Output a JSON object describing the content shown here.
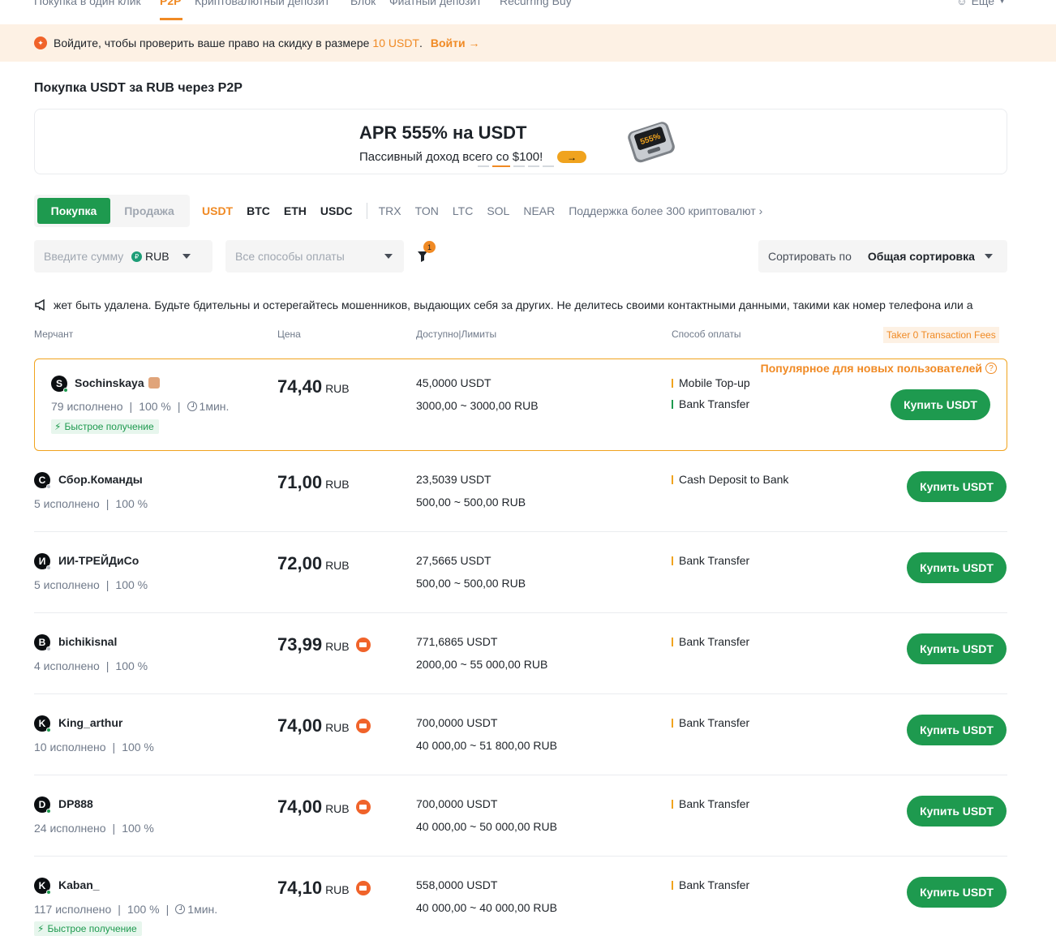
{
  "topnav": {
    "items": [
      "Покупка в один клик",
      "P2P",
      "Криптовалютный депозит",
      "Блок",
      "Фиатный депозит",
      "Recurring Buy"
    ],
    "more": "Еще"
  },
  "promo": {
    "text": "Войдите, чтобы проверить ваше право на скидку в размере",
    "amount": "10 USDT",
    "dot": ".",
    "login": "Войти →"
  },
  "page_title": "Покупка USDT за RUB через P2P",
  "banner": {
    "title": "APR 555% на USDT",
    "subtitle": "Пассивный доход всего со $100!",
    "device_text": "555%"
  },
  "tradeSide": {
    "buy": "Покупка",
    "sell": "Продажа"
  },
  "coins": {
    "primary": [
      "USDT",
      "BTC",
      "ETH",
      "USDC"
    ],
    "secondary": [
      "TRX",
      "TON",
      "LTC",
      "SOL",
      "NEAR"
    ],
    "more": "Поддержка более 300 криптовалют ›"
  },
  "filters": {
    "amount_placeholder": "Введите сумму",
    "currency": "RUB",
    "payment": "Все способы оплаты",
    "filter_count": "1",
    "sort_label": "Сортировать по",
    "sort_value": "Общая сортировка"
  },
  "notice": "жет быть удалена. Будьте бдительны и остерегайтесь мошенников, выдающих себя за других. Не делитесь своими контактными данными, такими как номер телефона или а",
  "table_header": {
    "merchant": "Мерчант",
    "price": "Цена",
    "avail": "Доступно|Лимиты",
    "payment": "Способ оплаты",
    "taker": "Taker 0 Transaction Fees"
  },
  "popular_label": "Популярное для новых пользователей",
  "fast_label": "Быстрое получение",
  "buy_label": "Купить USDT",
  "colors": {
    "accent": "#f08a24",
    "buy": "#1e9a4f"
  },
  "offers": [
    {
      "initial": "S",
      "name": "Sochinskaya",
      "orders": "79 исполнено",
      "rate": "100 %",
      "time": "1мин.",
      "price": "74,40",
      "cur": "RUB",
      "avail": "45,0000 USDT",
      "limits": "3000,00 ~ 3000,00 RUB",
      "payments": [
        "Mobile Top-up",
        "Bank Transfer"
      ]
    },
    {
      "initial": "С",
      "name": "Сбор.Команды",
      "orders": "5 исполнено",
      "rate": "100 %",
      "price": "71,00",
      "cur": "RUB",
      "avail": "23,5039 USDT",
      "limits": "500,00 ~ 500,00 RUB",
      "payments": [
        "Cash Deposit to Bank"
      ]
    },
    {
      "initial": "И",
      "name": "ИИ-ТРЕЙДиСо",
      "orders": "5 исполнено",
      "rate": "100 %",
      "price": "72,00",
      "cur": "RUB",
      "avail": "27,5665 USDT",
      "limits": "500,00 ~ 500,00 RUB",
      "payments": [
        "Bank Transfer"
      ]
    },
    {
      "initial": "B",
      "name": "bichikisnal",
      "orders": "4 исполнено",
      "rate": "100 %",
      "price": "73,99",
      "cur": "RUB",
      "avail": "771,6865 USDT",
      "limits": "2000,00 ~ 55 000,00 RUB",
      "payments": [
        "Bank Transfer"
      ]
    },
    {
      "initial": "K",
      "name": "King_arthur",
      "orders": "10 исполнено",
      "rate": "100 %",
      "price": "74,00",
      "cur": "RUB",
      "avail": "700,0000 USDT",
      "limits": "40 000,00 ~ 51 800,00 RUB",
      "payments": [
        "Bank Transfer"
      ]
    },
    {
      "initial": "D",
      "name": "DP888",
      "orders": "24 исполнено",
      "rate": "100 %",
      "price": "74,00",
      "cur": "RUB",
      "avail": "700,0000 USDT",
      "limits": "40 000,00 ~ 50 000,00 RUB",
      "payments": [
        "Bank Transfer"
      ]
    },
    {
      "initial": "K",
      "name": "Kaban_",
      "orders": "117 исполнено",
      "rate": "100 %",
      "time": "1мин.",
      "price": "74,10",
      "cur": "RUB",
      "avail": "558,0000 USDT",
      "limits": "40 000,00 ~ 40 000,00 RUB",
      "payments": [
        "Bank Transfer"
      ]
    }
  ]
}
